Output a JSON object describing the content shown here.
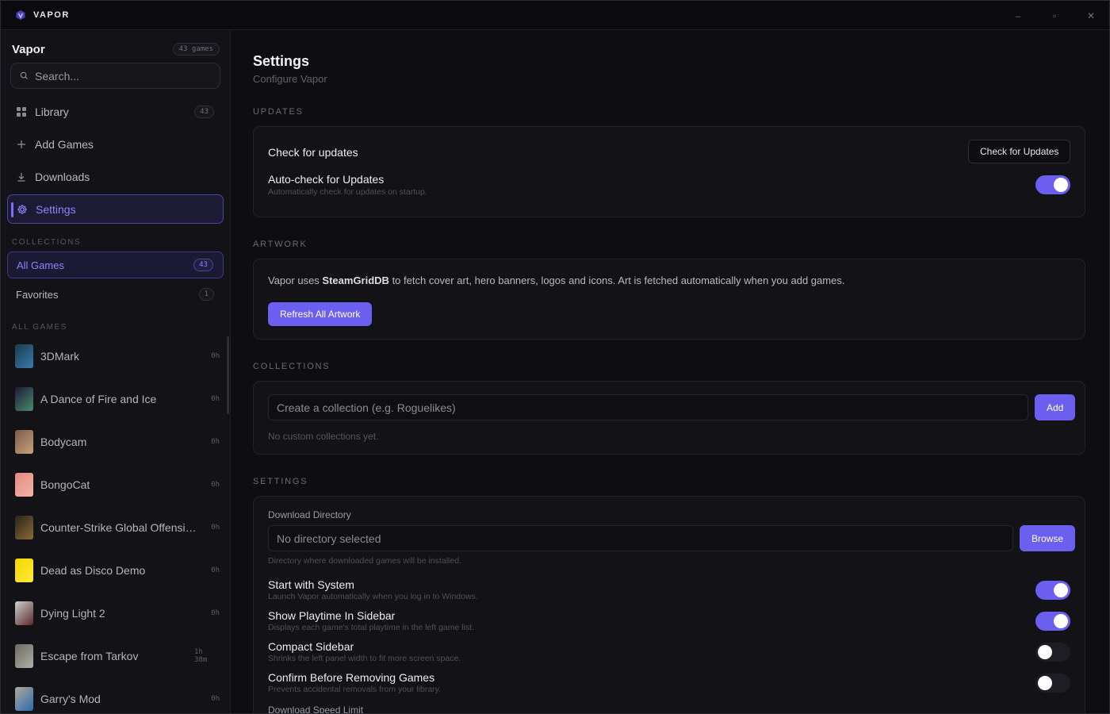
{
  "window": {
    "app_name": "VAPOR",
    "controls": {
      "minimize": "–",
      "maximize": "▫",
      "close": "✕"
    }
  },
  "sidebar": {
    "title": "Vapor",
    "game_count_badge": "43 games",
    "search_placeholder": "Search...",
    "nav": [
      {
        "label": "Library",
        "icon": "grid-icon",
        "count": "43"
      },
      {
        "label": "Add Games",
        "icon": "plus-icon",
        "count": ""
      },
      {
        "label": "Downloads",
        "icon": "download-icon",
        "count": ""
      },
      {
        "label": "Settings",
        "icon": "gear-icon",
        "count": "",
        "active": true
      }
    ],
    "collections_label": "COLLECTIONS",
    "collections": [
      {
        "label": "All Games",
        "count": "43",
        "active": true
      },
      {
        "label": "Favorites",
        "count": "1"
      }
    ],
    "all_games_label": "ALL GAMES",
    "games": [
      {
        "name": "3DMark",
        "time": "0h",
        "thumb": [
          "#1a3a4a",
          "#3a7ab0"
        ]
      },
      {
        "name": "A Dance of Fire and Ice",
        "time": "0h",
        "thumb": [
          "#1c1c3a",
          "#4b8a6a"
        ]
      },
      {
        "name": "Bodycam",
        "time": "0h",
        "thumb": [
          "#7a5a4a",
          "#c9a27a"
        ]
      },
      {
        "name": "BongoCat",
        "time": "0h",
        "thumb": [
          "#e28a80",
          "#f2b6a6"
        ]
      },
      {
        "name": "Counter-Strike Global Offensive",
        "time": "0h",
        "thumb": [
          "#2a2418",
          "#8a6a3a"
        ]
      },
      {
        "name": "Dead as Disco Demo",
        "time": "0h",
        "thumb": [
          "#f4d800",
          "#ffe83a"
        ]
      },
      {
        "name": "Dying Light 2",
        "time": "0h",
        "thumb": [
          "#cfcfcf",
          "#5a2a2a"
        ]
      },
      {
        "name": "Escape from Tarkov",
        "time": "1h 38m",
        "thumb": [
          "#6a6a64",
          "#b0b0a6"
        ]
      },
      {
        "name": "Garry's Mod",
        "time": "0h",
        "thumb": [
          "#b0a89a",
          "#2a6ab0"
        ]
      }
    ]
  },
  "main": {
    "title": "Settings",
    "subtitle": "Configure Vapor",
    "updates": {
      "heading": "UPDATES",
      "check_label": "Check for updates",
      "check_button": "Check for Updates",
      "auto_title": "Auto-check for Updates",
      "auto_desc": "Automatically check for updates on startup.",
      "auto_on": true
    },
    "artwork": {
      "heading": "ARTWORK",
      "text_before": "Vapor uses ",
      "text_strong": "SteamGridDB",
      "text_after": " to fetch cover art, hero banners, logos and icons. Art is fetched automatically when you add games.",
      "refresh_button": "Refresh All Artwork"
    },
    "collections": {
      "heading": "COLLECTIONS",
      "input_placeholder": "Create a collection (e.g. Roguelikes)",
      "add_button": "Add",
      "empty_text": "No custom collections yet."
    },
    "settings": {
      "heading": "SETTINGS",
      "download_dir_label": "Download Directory",
      "download_dir_placeholder": "No directory selected",
      "browse_button": "Browse",
      "download_dir_desc": "Directory where downloaded games will be installed.",
      "toggles": [
        {
          "title": "Start with System",
          "desc": "Launch Vapor automatically when you log in to Windows.",
          "on": true
        },
        {
          "title": "Show Playtime In Sidebar",
          "desc": "Displays each game's total playtime in the left game list.",
          "on": true
        },
        {
          "title": "Compact Sidebar",
          "desc": "Shrinks the left panel width to fit more screen space.",
          "on": false
        },
        {
          "title": "Confirm Before Removing Games",
          "desc": "Prevents accidental removals from your library.",
          "on": false
        }
      ],
      "speed_limit_label": "Download Speed Limit"
    }
  },
  "colors": {
    "accent": "#6c5ff0",
    "accent_text": "#8e83ff",
    "background": "#0e0e12",
    "card": "#121217"
  }
}
